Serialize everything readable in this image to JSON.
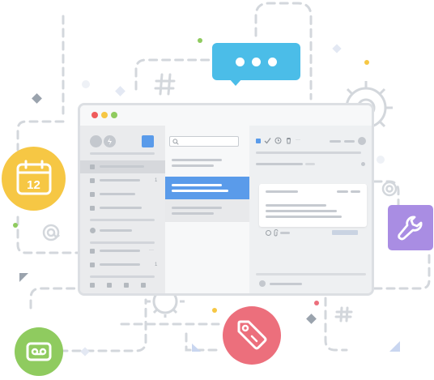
{
  "window_controls": {
    "close_color": "#ef5b5b",
    "minimize_color": "#f6c744",
    "maximize_color": "#8fcb5f"
  },
  "calendar": {
    "day": "12",
    "color": "#f6c744"
  },
  "chat_bubble": {
    "color": "#4bbde8"
  },
  "tag_badge": {
    "color": "#ec6f7c"
  },
  "tools_badge": {
    "color": "#a98de3"
  },
  "voicemail_badge": {
    "color": "#8fcb5f"
  },
  "sidebar": {
    "counts": [
      "1",
      "1"
    ],
    "more_glyph": "···"
  },
  "reader_toolbar": {
    "more_glyph": "···"
  },
  "search": {
    "placeholder": "",
    "value": ""
  },
  "icons": [
    "search-icon",
    "check-icon",
    "clock-icon",
    "trash-icon",
    "calendar-icon",
    "chat-bubble-icon",
    "tag-icon",
    "wrench-icon",
    "voicemail-icon",
    "gear-icon",
    "at-icon",
    "hash-icon"
  ]
}
